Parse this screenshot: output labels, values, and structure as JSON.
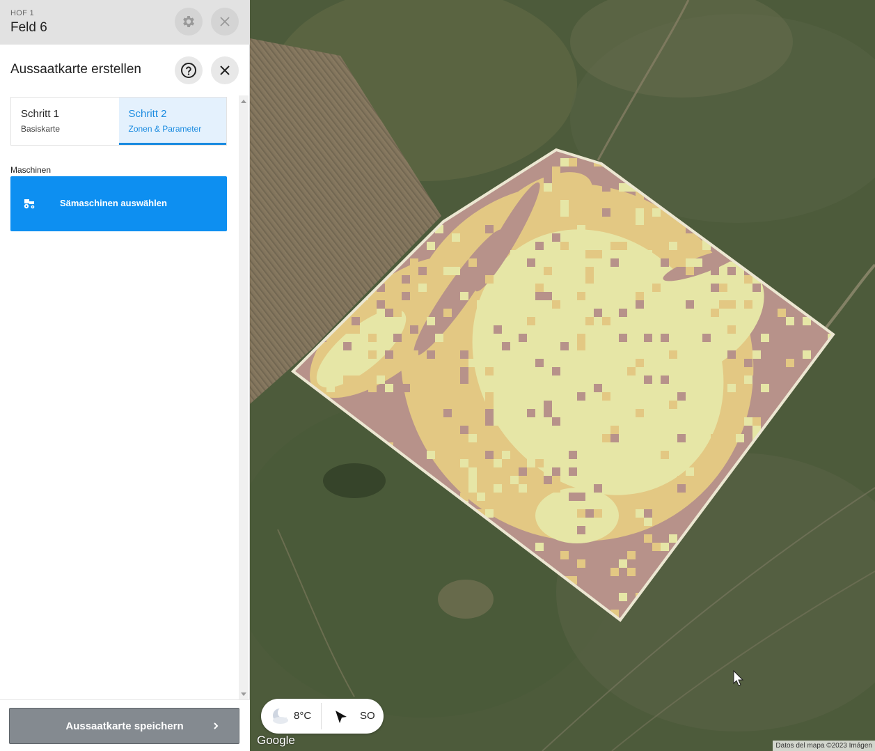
{
  "header": {
    "farm_label": "HOF 1",
    "field_name": "Feld 6"
  },
  "panel": {
    "title": "Aussaatkarte erstellen"
  },
  "steps": [
    {
      "title": "Schritt 1",
      "subtitle": "Basiskarte",
      "active": false
    },
    {
      "title": "Schritt 2",
      "subtitle": "Zonen & Parameter",
      "active": true
    }
  ],
  "machines": {
    "section_label": "Maschinen",
    "button_label": "Sämaschinen auswählen"
  },
  "footer": {
    "save_label": "Aussaatkarte speichern"
  },
  "map": {
    "weather": {
      "temperature": "8°C",
      "wind_direction": "SO",
      "icon": "moon-cloud-icon"
    },
    "google_logo": "Google",
    "attribution": "Datos del mapa ©2023 Imágen"
  },
  "colors": {
    "accent": "#0d8ff1",
    "step_active": "#1a8be0",
    "zone_high": "#e6e6a6",
    "zone_mid": "#e3c883",
    "zone_low": "#b7928a",
    "field_border": "#ece7d2"
  }
}
